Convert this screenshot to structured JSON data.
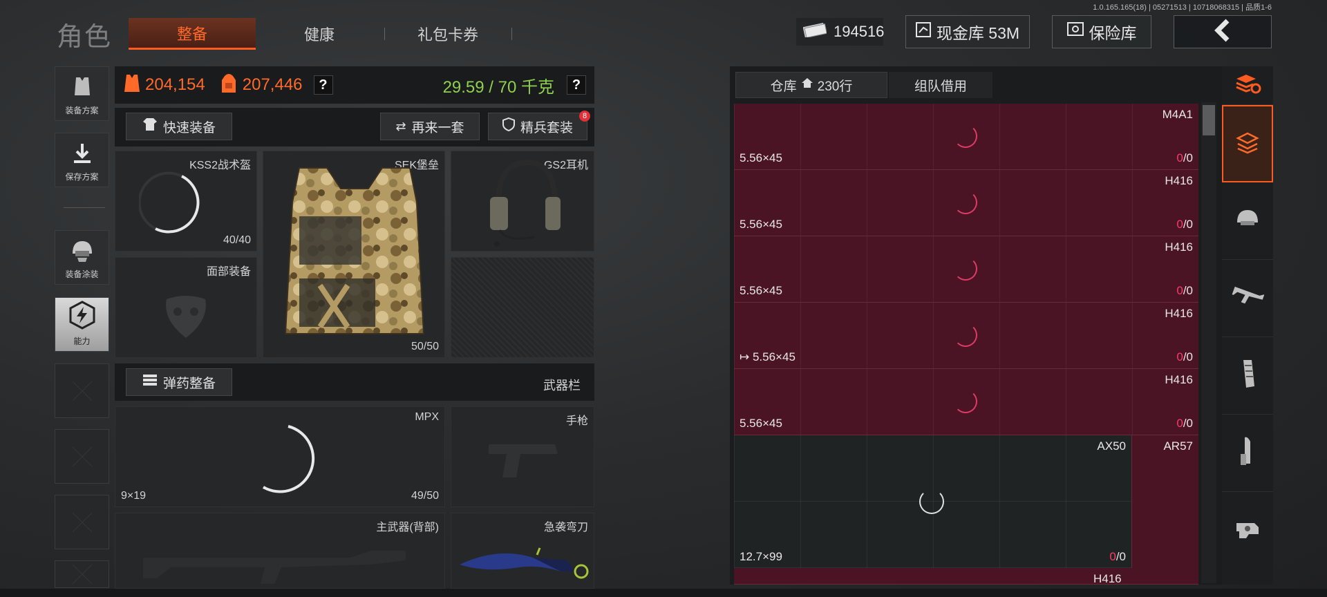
{
  "version": "1.0.165.165(18) | 05271513 | 10718068315 | 品质1-6",
  "header": {
    "role_title": "角色",
    "tabs": [
      {
        "label": "整备",
        "active": true
      },
      {
        "label": "健康",
        "active": false
      },
      {
        "label": "礼包卡券",
        "active": false
      }
    ],
    "cash_value": "194516",
    "cash_vault_label": "现金库 53M",
    "safe_label": "保险库"
  },
  "sidebar": {
    "items": [
      {
        "label": "装备方案",
        "icon": "vest-plan-icon"
      },
      {
        "label": "保存方案",
        "icon": "download-icon"
      },
      {
        "label": "装备涂装",
        "icon": "helmet-skin-icon"
      },
      {
        "label": "能力",
        "icon": "ability-icon"
      }
    ]
  },
  "stats": {
    "armor_value": "204,154",
    "backpack_value": "207,446",
    "help1": "?",
    "weight": "29.59 / 70 千克",
    "help2": "?"
  },
  "actions": {
    "quick_equip": "快速装备",
    "reequip": "再来一套",
    "elite_set": "精兵套装",
    "elite_badge": "8",
    "ammo_equip": "弹药整备",
    "weapon_bar": "武器栏"
  },
  "slots": {
    "helmet": {
      "label": "KSS2战术盔",
      "value": "40/40"
    },
    "armor": {
      "label": "SEK堡垒",
      "value": "50/50"
    },
    "headset": {
      "label": "GS2耳机"
    },
    "face": {
      "label": "面部装备"
    },
    "smg": {
      "label": "MPX",
      "caliber": "9×19",
      "value": "49/50"
    },
    "pistol": {
      "label": "手枪"
    },
    "primary_back": {
      "label": "主武器(背部)"
    },
    "melee": {
      "label": "急袭弯刀"
    }
  },
  "warehouse": {
    "tab_storage": "仓库",
    "tab_rows": "230行",
    "tab_team": "组队借用",
    "rows": [
      {
        "name": "M4A1",
        "caliber": "5.56×45",
        "count_zero": "0",
        "count_rest": "/0"
      },
      {
        "name": "H416",
        "caliber": "5.56×45",
        "count_zero": "0",
        "count_rest": "/0"
      },
      {
        "name": "H416",
        "caliber": "5.56×45",
        "count_zero": "0",
        "count_rest": "/0"
      },
      {
        "name": "H416",
        "caliber": "5.56×45",
        "count_zero": "0",
        "count_rest": "/0"
      },
      {
        "name": "H416",
        "caliber": "5.56×45",
        "count_zero": "0",
        "count_rest": "/0"
      }
    ],
    "big_item": {
      "name": "AX50",
      "caliber": "12.7×99",
      "count_zero": "0",
      "count_rest": "/0"
    },
    "side_item": {
      "name": "AR57"
    },
    "last_item": {
      "name": "H416"
    }
  },
  "categories": [
    {
      "icon": "stack-refresh-icon"
    },
    {
      "icon": "layers-icon"
    },
    {
      "icon": "helmet-icon"
    },
    {
      "icon": "rifle-icon"
    },
    {
      "icon": "magazine-icon"
    },
    {
      "icon": "bullet-icon"
    },
    {
      "icon": "scope-icon"
    }
  ],
  "colors": {
    "accent": "#ff5a1f",
    "weight_green": "#8fd14f",
    "warehouse_row": "#4a1424",
    "count_zero": "#ff3a6a"
  }
}
